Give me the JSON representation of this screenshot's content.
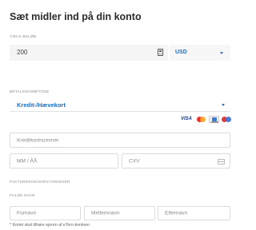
{
  "page": {
    "title": "Sæt midler ind på din konto"
  },
  "amount": {
    "label": "VÆLG BELØB",
    "value": "200",
    "currency": "USD"
  },
  "payment": {
    "label": "BETALINGSMETODE",
    "method": "Kredit-/Hævekort",
    "card_brands": [
      "visa",
      "mastercard",
      "paypal",
      "maestro"
    ],
    "visa_text": "VISA"
  },
  "card": {
    "number_placeholder": "Kreditkortnummer",
    "expiry_placeholder": "MM / ÅÅ",
    "cvv_placeholder": "CVV"
  },
  "billing": {
    "label": "FAKTURERINGSOPLYSNINGER"
  },
  "name": {
    "label": "FULDE NAVN",
    "first_placeholder": "Fornavn",
    "middle_placeholder": "Mellemnavn",
    "last_placeholder": "Efternavn",
    "note": "* Kortet skal tilhøre ejeren af eToro-kontoen"
  },
  "colors": {
    "accent": "#1a6fc4",
    "field_bg": "#f5f5f5",
    "text": "#3a3a3a"
  }
}
